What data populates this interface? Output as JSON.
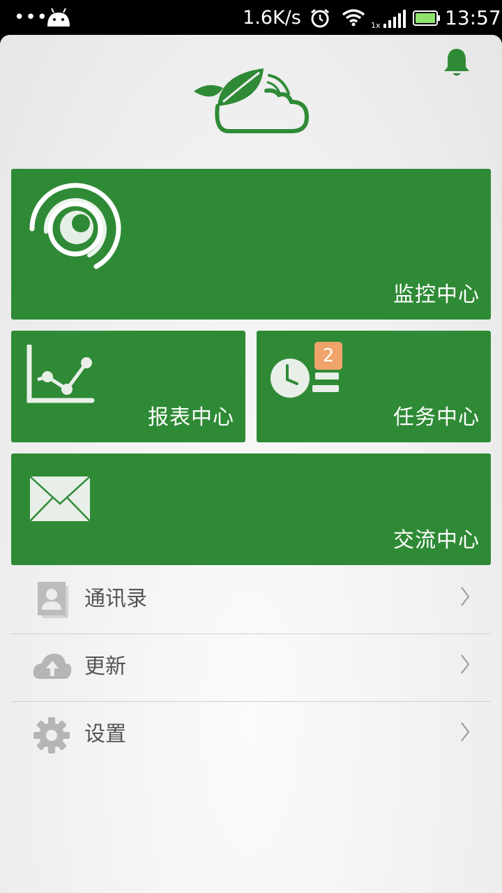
{
  "status_bar": {
    "dots": "•••",
    "net_speed": "1.6K/s",
    "time": "13:57",
    "icons": [
      "android-icon",
      "alarm-icon",
      "wifi-icon",
      "signal-icon",
      "battery-icon"
    ]
  },
  "header": {
    "logo": "leaf-cloud-logo",
    "notification_icon": "bell-icon"
  },
  "tiles": {
    "monitor": {
      "label": "监控中心",
      "icon": "camera-eye-icon"
    },
    "report": {
      "label": "报表中心",
      "icon": "line-chart-icon"
    },
    "task": {
      "label": "任务中心",
      "icon": "clock-list-icon",
      "badge": "2"
    },
    "comm": {
      "label": "交流中心",
      "icon": "envelope-icon"
    }
  },
  "menu": {
    "items": [
      {
        "label": "通讯录",
        "icon": "contacts-icon"
      },
      {
        "label": "更新",
        "icon": "cloud-upload-icon"
      },
      {
        "label": "设置",
        "icon": "gear-icon"
      }
    ]
  },
  "colors": {
    "tile_green": "#2f8a36",
    "badge_orange": "#f0a36a",
    "menu_text": "#555555",
    "menu_icon": "#b5b5b5"
  }
}
